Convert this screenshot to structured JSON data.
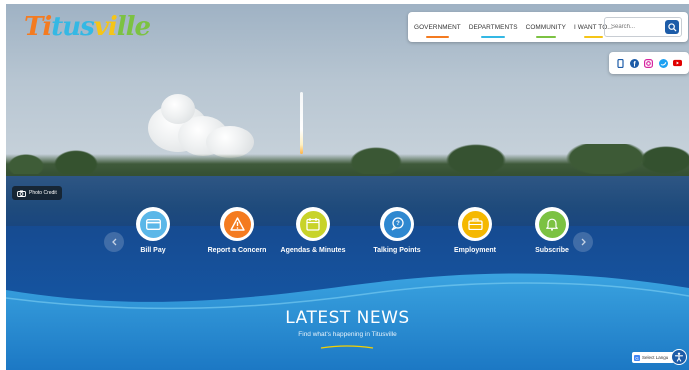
{
  "logo": {
    "parts": [
      "Ti",
      "tus",
      "vi",
      "lle"
    ]
  },
  "nav": {
    "items": [
      {
        "label": "GOVERNMENT",
        "color": "#f47b20"
      },
      {
        "label": "DEPARTMENTS",
        "color": "#34b8e4"
      },
      {
        "label": "COMMUNITY",
        "color": "#7cc242"
      },
      {
        "label": "I WANT TO...",
        "color": "#f5c518"
      }
    ],
    "search_placeholder": "Search..."
  },
  "social": {
    "icons": [
      "mobile-icon",
      "facebook-icon",
      "instagram-icon",
      "twitter-icon",
      "youtube-icon"
    ]
  },
  "hero": {
    "photo_credit": "Photo Credit"
  },
  "quick_links": [
    {
      "label": "Bill Pay",
      "icon": "credit-card-icon",
      "color": "#5bb7e8"
    },
    {
      "label": "Report a Concern",
      "icon": "warning-icon",
      "color": "#f47b20"
    },
    {
      "label": "Agendas & Minutes",
      "icon": "calendar-icon",
      "color": "#c8d32a"
    },
    {
      "label": "Talking Points",
      "icon": "speech-bubble-icon",
      "color": "#2f88d0"
    },
    {
      "label": "Employment",
      "icon": "briefcase-icon",
      "color": "#f5b800"
    },
    {
      "label": "Subscribe",
      "icon": "bell-icon",
      "color": "#7cc242"
    }
  ],
  "news": {
    "title": "LATEST NEWS",
    "subtitle": "Find what's happening in Titusville"
  },
  "translate": {
    "label": "Select Langu"
  },
  "colors": {
    "brand_blue": "#1d5ca8",
    "band_blue": "#164b91",
    "wave_light": "#4fb5e6"
  }
}
